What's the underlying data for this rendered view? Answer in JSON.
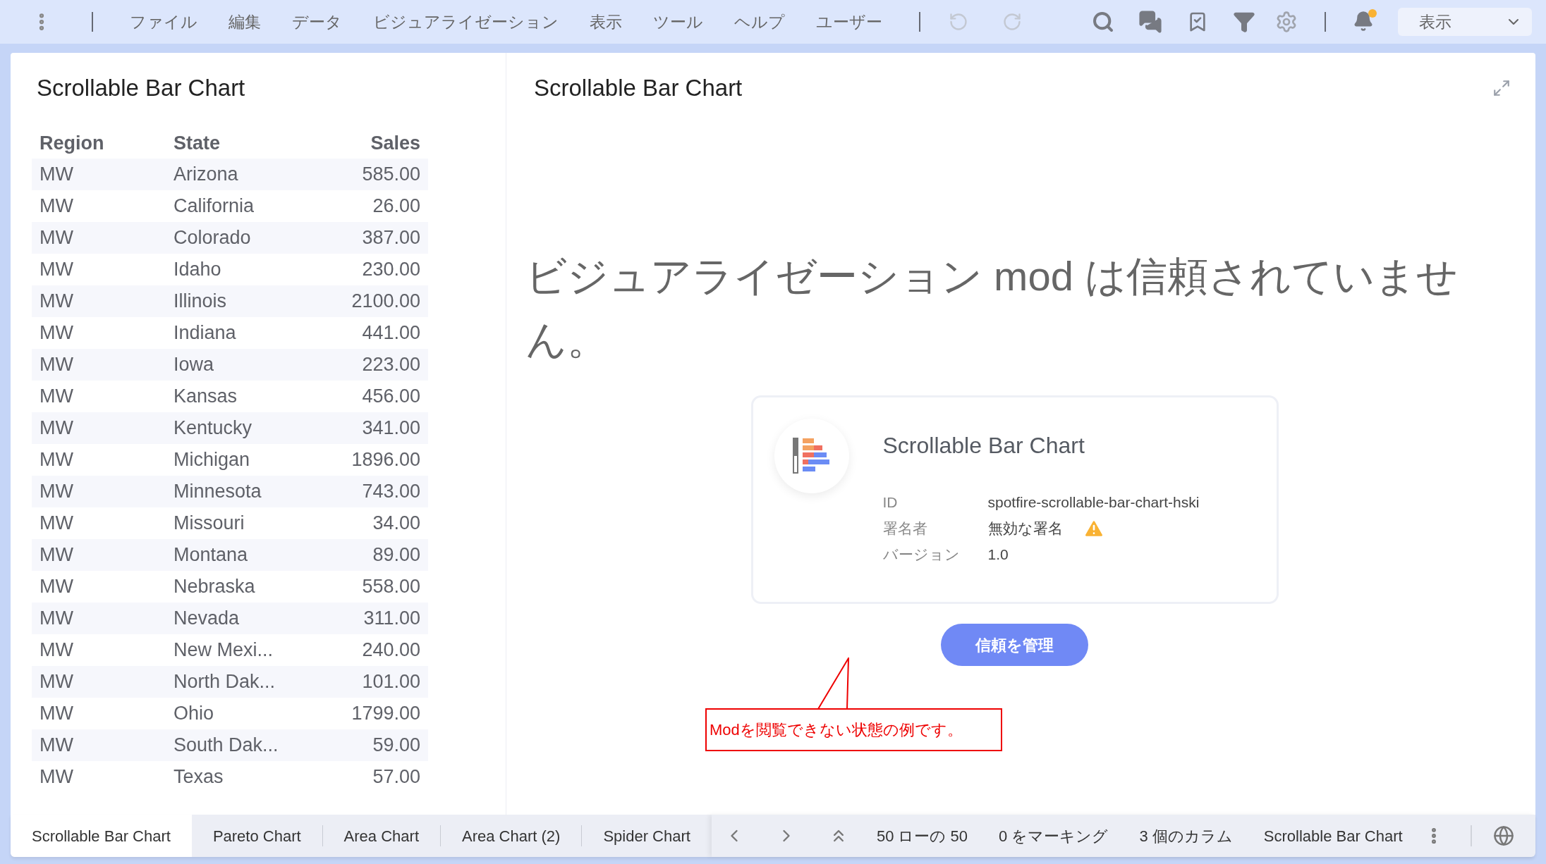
{
  "menu": [
    "ファイル",
    "編集",
    "データ",
    "ビジュアライゼーション",
    "表示",
    "ツール",
    "ヘルプ",
    "ユーザー"
  ],
  "view_dropdown": {
    "value": "表示"
  },
  "left_panel": {
    "title": "Scrollable Bar Chart",
    "table": {
      "columns": [
        "Region",
        "State",
        "Sales"
      ],
      "rows": [
        [
          "MW",
          "Arizona",
          "585.00"
        ],
        [
          "MW",
          "California",
          "26.00"
        ],
        [
          "MW",
          "Colorado",
          "387.00"
        ],
        [
          "MW",
          "Idaho",
          "230.00"
        ],
        [
          "MW",
          "Illinois",
          "2100.00"
        ],
        [
          "MW",
          "Indiana",
          "441.00"
        ],
        [
          "MW",
          "Iowa",
          "223.00"
        ],
        [
          "MW",
          "Kansas",
          "456.00"
        ],
        [
          "MW",
          "Kentucky",
          "341.00"
        ],
        [
          "MW",
          "Michigan",
          "1896.00"
        ],
        [
          "MW",
          "Minnesota",
          "743.00"
        ],
        [
          "MW",
          "Missouri",
          "34.00"
        ],
        [
          "MW",
          "Montana",
          "89.00"
        ],
        [
          "MW",
          "Nebraska",
          "558.00"
        ],
        [
          "MW",
          "Nevada",
          "311.00"
        ],
        [
          "MW",
          "New Mexi...",
          "240.00"
        ],
        [
          "MW",
          "North Dak...",
          "101.00"
        ],
        [
          "MW",
          "Ohio",
          "1799.00"
        ],
        [
          "MW",
          "South Dak...",
          "59.00"
        ],
        [
          "MW",
          "Texas",
          "57.00"
        ]
      ]
    }
  },
  "right_panel": {
    "title": "Scrollable Bar Chart",
    "message": "ビジュアライゼーション mod は信頼されていません。",
    "card": {
      "title": "Scrollable Bar Chart",
      "fields": [
        {
          "label": "ID",
          "value": "spotfire-scrollable-bar-chart-hski",
          "warning": false
        },
        {
          "label": "署名者",
          "value": "無効な署名",
          "warning": true
        },
        {
          "label": "バージョン",
          "value": "1.0",
          "warning": false
        }
      ]
    },
    "button": "信頼を管理",
    "annotation": "Modを閲覧できない状態の例です。"
  },
  "page_tabs": [
    {
      "label": "Scrollable Bar Chart",
      "selected": true
    },
    {
      "label": "Pareto Chart",
      "selected": false
    },
    {
      "label": "Area Chart",
      "selected": false
    },
    {
      "label": "Area Chart (2)",
      "selected": false
    },
    {
      "label": "Spider Chart",
      "selected": false
    }
  ],
  "status_bar": [
    "50 ローの 50",
    "0 をマーキング",
    "3 個のカラム",
    "Scrollable Bar Chart"
  ]
}
